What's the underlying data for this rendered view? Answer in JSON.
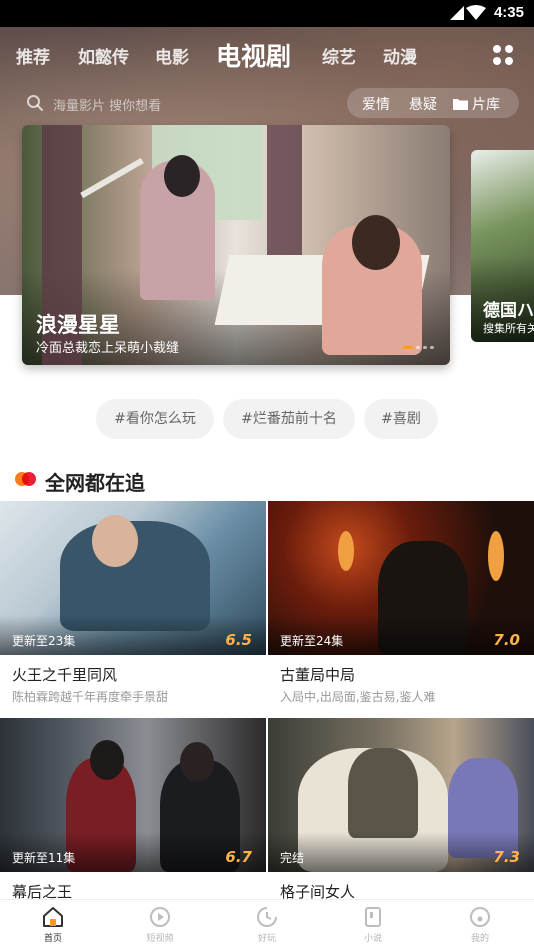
{
  "status_bar": {
    "time": "4:35"
  },
  "top_tabs": {
    "items": [
      "推荐",
      "如懿传",
      "电影",
      "电视剧",
      "综艺",
      "动漫"
    ],
    "active_index": 3
  },
  "search": {
    "placeholder": "海量影片 搜你想看",
    "quick_links": [
      "爱情",
      "悬疑",
      "片库"
    ]
  },
  "banner": {
    "title": "浪漫星星",
    "subtitle": "冷面总裁恋上呆萌小裁缝",
    "next_title": "德国ハ",
    "next_subtitle": "搜集所有关"
  },
  "hashtags": [
    "#看你怎么玩",
    "#烂番茄前十名",
    "#喜剧"
  ],
  "section": {
    "title": "全网都在追"
  },
  "shows": [
    {
      "title": "火王之千里同风",
      "desc": "陈柏霖跨越千年再度牵手景甜",
      "episode": "更新至23集",
      "score": "6.5"
    },
    {
      "title": "古董局中局",
      "desc": "入局中,出局面,鉴古易,鉴人难",
      "episode": "更新至24集",
      "score": "7.0"
    },
    {
      "title": "幕后之王",
      "desc": "",
      "episode": "更新至11集",
      "score": "6.7"
    },
    {
      "title": "格子间女人",
      "desc": "",
      "episode": "完结",
      "score": "7.3"
    }
  ],
  "bottom_nav": {
    "items": [
      "首页",
      "短视频",
      "好玩",
      "小说",
      "我的"
    ],
    "active_index": 0
  },
  "colors": {
    "accent": "#ff9a2a",
    "score": "#ffb34a",
    "chip_bg": "#f2f2f2"
  }
}
